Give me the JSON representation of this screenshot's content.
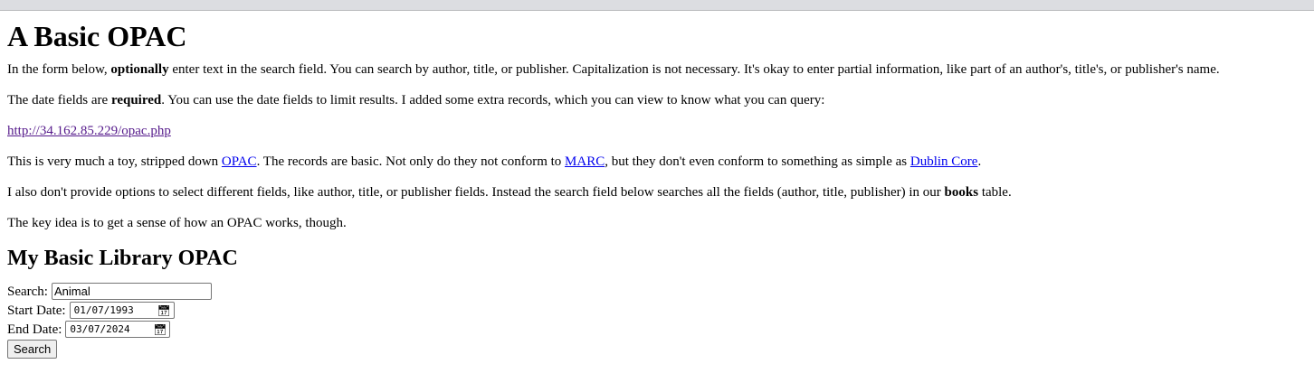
{
  "page": {
    "title": "A Basic OPAC",
    "p1": {
      "a": "In the form below, ",
      "b": "optionally",
      "c": " enter text in the search field. You can search by author, title, or publisher. Capitalization is not necessary. It's okay to enter partial information, like part of an author's, title's, or publisher's name."
    },
    "p2": {
      "a": "The date fields are ",
      "b": "required",
      "c": ". You can use the date fields to limit results. I added some extra records, which you can view to know what you can query:"
    },
    "link_url": "http://34.162.85.229/opac.php",
    "p3": {
      "a": "This is very much a toy, stripped down ",
      "opac_link": "OPAC",
      "b": ". The records are basic. Not only do they not conform to ",
      "marc_link": "MARC",
      "c": ", but they don't even conform to something as simple as ",
      "dublin_link": "Dublin Core",
      "d": "."
    },
    "p4": {
      "a": "I also don't provide options to select different fields, like author, title, or publisher fields. Instead the search field below searches all the fields (author, title, publisher) in our ",
      "b": "books",
      "c": " table."
    },
    "p5": "The key idea is to get a sense of how an OPAC works, though."
  },
  "form": {
    "heading": "My Basic Library OPAC",
    "search_label": "Search:",
    "search_value": "Animal",
    "start_label": "Start Date:",
    "start_value": "01/07/1993",
    "end_label": "End Date:",
    "end_value": "03/07/2024",
    "button_label": "Search",
    "calendar_icon": "calendar-icon"
  },
  "colors": {
    "link": "#0000ee",
    "visited_link": "#551a8b",
    "tab_strip": "#dcdde1"
  }
}
